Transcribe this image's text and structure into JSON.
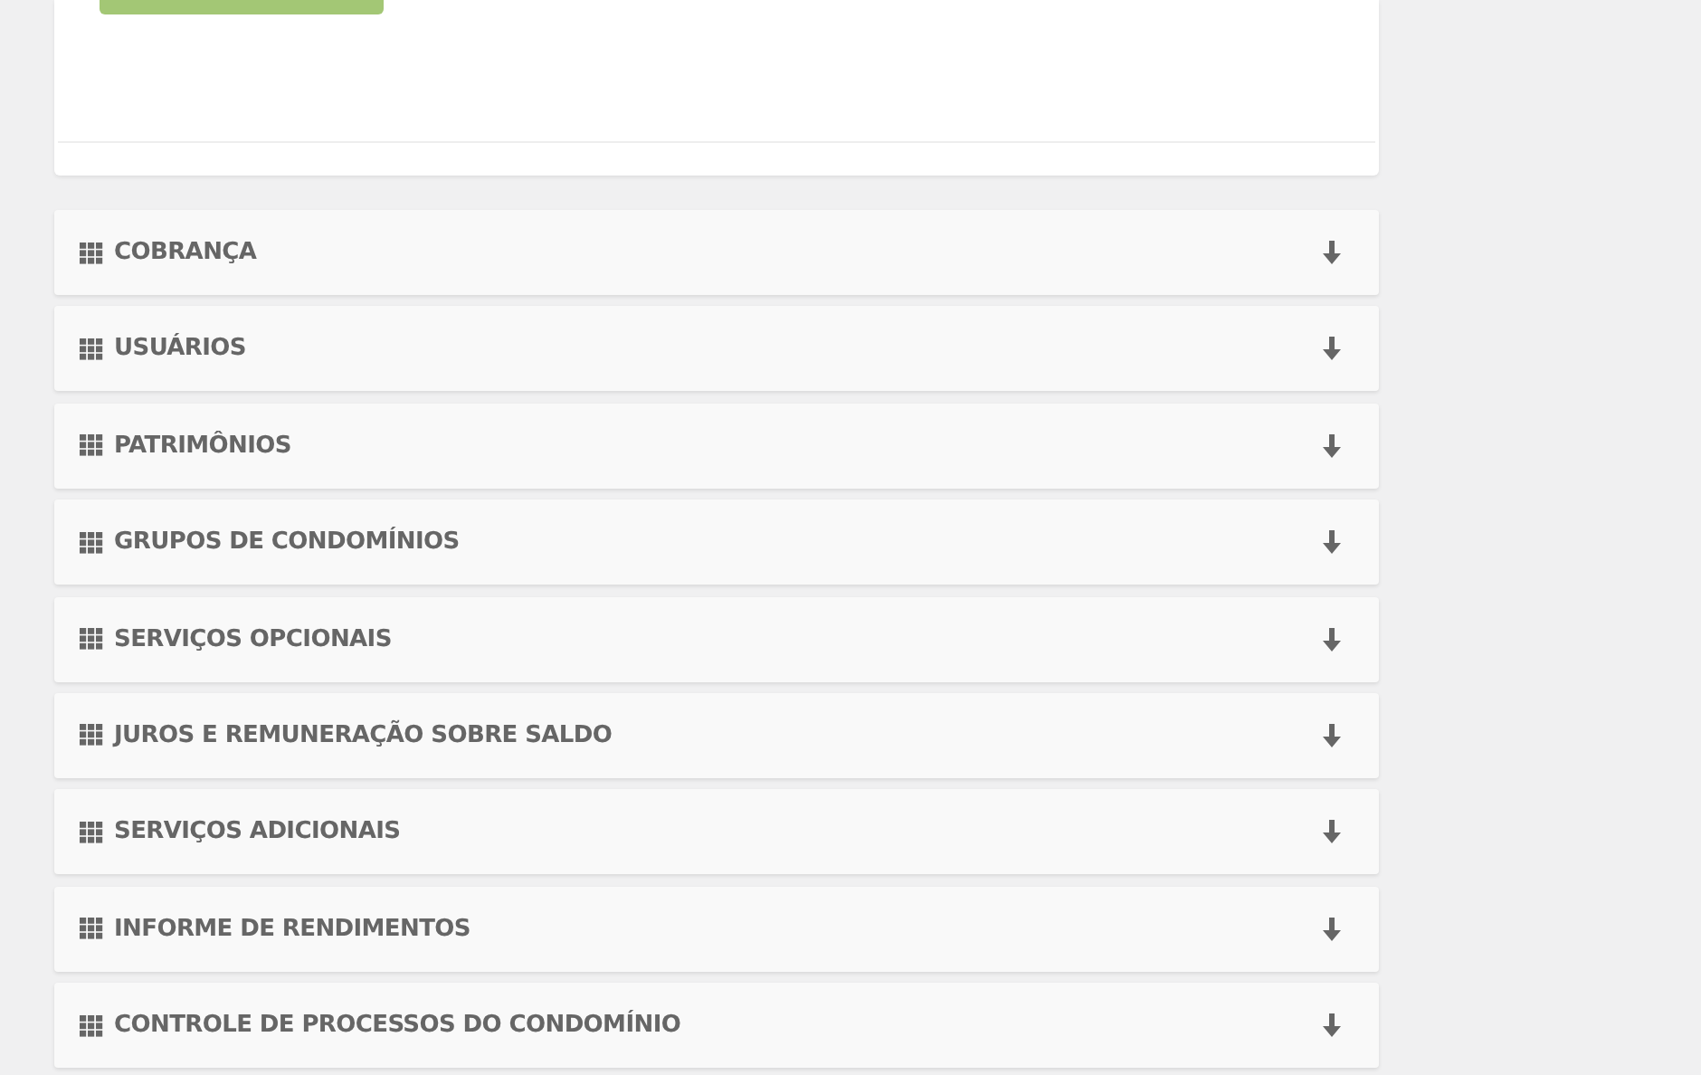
{
  "panels": [
    {
      "title": "COBRANÇA",
      "expanded": false
    },
    {
      "title": "USUÁRIOS",
      "expanded": false
    },
    {
      "title": "PATRIMÔNIOS",
      "expanded": false
    },
    {
      "title": "GRUPOS DE CONDOMÍNIOS",
      "expanded": false
    },
    {
      "title": "SERVIÇOS OPCIONAIS",
      "expanded": false
    },
    {
      "title": "JUROS E REMUNERAÇÃO SOBRE SALDO",
      "expanded": false
    },
    {
      "title": "SERVIÇOS ADICIONAIS",
      "expanded": false
    },
    {
      "title": "INFORME DE RENDIMENTOS",
      "expanded": false
    },
    {
      "title": "CONTROLE DE PROCESSOS DO CONDOMÍNIO",
      "expanded": false
    }
  ]
}
